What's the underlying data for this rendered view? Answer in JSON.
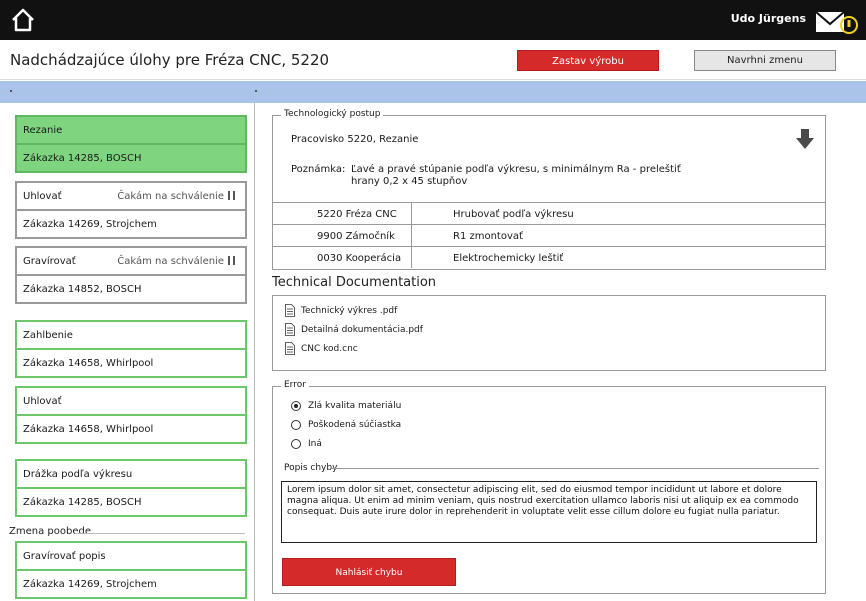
{
  "topbar": {
    "user_name": "Udo Jürgens"
  },
  "header": {
    "title": "Nadchádzajúce úlohy pre Fréza CNC, 5220",
    "stop_label": "Zastav výrobu",
    "shift_label": "Navrhni zmenu"
  },
  "tasks": [
    {
      "name": "Rezanie",
      "order": "Zákazka 14285, BOSCH",
      "status": "",
      "style": "green"
    },
    {
      "name": "Uhlovať",
      "order": "Zákazka 14269, Strojchem",
      "status": "Čakám na schválenie",
      "style": "grey"
    },
    {
      "name": "Gravírovať",
      "order": "Zákazka 14852, BOSCH",
      "status": "Čakám na schválenie",
      "style": "grey"
    },
    {
      "name": "Zahlbenie",
      "order": "Zákazka 14658, Whirlpool",
      "status": "",
      "style": "outline"
    },
    {
      "name": "Uhlovať",
      "order": "Zákazka 14658, Whirlpool",
      "status": "",
      "style": "outline"
    },
    {
      "name": "Drážka podľa výkresu",
      "order": "Zákazka 14285, BOSCH",
      "status": "",
      "style": "outline"
    }
  ],
  "afternoon": {
    "label": "Zmena poobede",
    "name": "Gravírovať popis",
    "order": "Zákazka 14269, Strojchem"
  },
  "tech": {
    "legend": "Technologický postup",
    "workplace": "Pracovisko 5220, Rezanie",
    "note_label": "Poznámka:",
    "note_line1": "Ľavé a pravé stúpanie podľa výkresu, s minimálnym Ra - preleštiť",
    "note_line2": "hrany 0,2 x 45 stupňov",
    "rows": [
      {
        "station": "5220 Fréza CNC",
        "op": "Hrubovať podľa výkresu"
      },
      {
        "station": "9900 Zámočník",
        "op": "R1 zmontovať"
      },
      {
        "station": "0030 Kooperácia",
        "op": "Elektrochemicky leštiť"
      }
    ]
  },
  "docs": {
    "title": "Technical Documentation",
    "files": [
      "Technický výkres .pdf",
      "Detailná dokumentácia.pdf",
      "CNC kod.cnc"
    ]
  },
  "error": {
    "legend": "Error",
    "options": [
      "Zlá kvalita materiálu",
      "Poškodená súčiastka",
      "Iná"
    ],
    "selected": 0,
    "desc_legend": "Popis chyby",
    "desc_text": "Lorem ipsum dolor sit amet, consectetur adipiscing elit, sed do eiusmod tempor incididunt ut labore et dolore magna aliqua. Ut enim ad minim veniam, quis nostrud exercitation ullamco laboris nisi ut aliquip ex ea commodo consequat. Duis aute irure dolor in reprehenderit in voluptate velit esse cillum dolore eu fugiat nulla pariatur.",
    "report_label": "Nahlásiť chybu"
  }
}
